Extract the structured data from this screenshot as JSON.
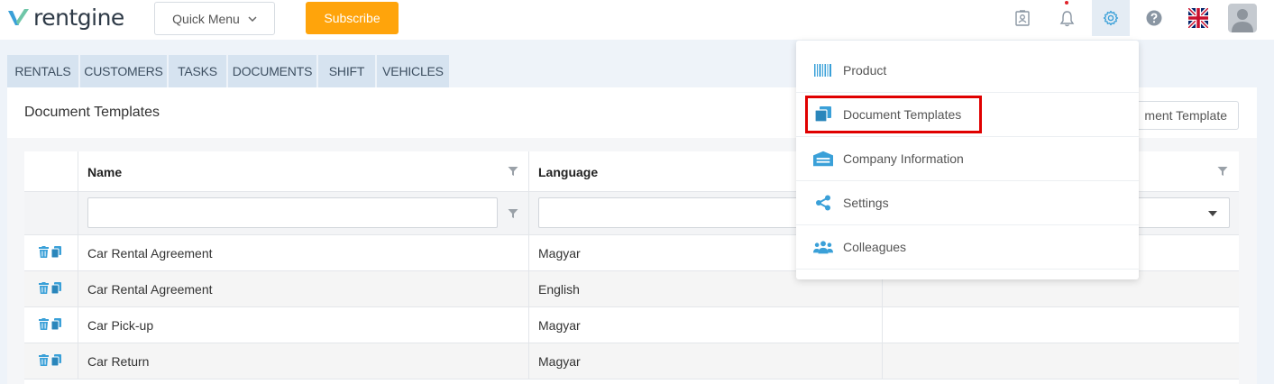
{
  "header": {
    "logo_text": "rentgine",
    "quick_menu_label": "Quick Menu",
    "subscribe_label": "Subscribe",
    "icons": [
      "contact-card-icon",
      "bell-icon",
      "gear-icon",
      "help-icon",
      "uk-flag-icon",
      "user-avatar-icon"
    ]
  },
  "tabs": [
    {
      "label": "RENTALS"
    },
    {
      "label": "CUSTOMERS"
    },
    {
      "label": "TASKS"
    },
    {
      "label": "DOCUMENTS"
    },
    {
      "label": "SHIFT"
    },
    {
      "label": "VEHICLES"
    }
  ],
  "panel": {
    "title": "Document Templates",
    "add_button_label": "ment Template"
  },
  "table": {
    "columns": [
      "Name",
      "Language"
    ],
    "rows": [
      {
        "name": "Car Rental Agreement",
        "language": "Magyar"
      },
      {
        "name": "Car Rental Agreement",
        "language": "English"
      },
      {
        "name": "Car Pick-up",
        "language": "Magyar"
      },
      {
        "name": "Car Return",
        "language": "Magyar"
      }
    ]
  },
  "settings_menu": {
    "items": [
      {
        "label": "Product",
        "icon": "barcode-icon"
      },
      {
        "label": "Document Templates",
        "icon": "documents-icon"
      },
      {
        "label": "Company Information",
        "icon": "building-icon"
      },
      {
        "label": "Settings",
        "icon": "share-icon"
      },
      {
        "label": "Colleagues",
        "icon": "users-icon"
      }
    ]
  },
  "colors": {
    "accent": "#ffa40b",
    "icon_blue": "#3aa0d8",
    "tab_bg": "#d6e3f0",
    "highlight": "#e00000"
  }
}
